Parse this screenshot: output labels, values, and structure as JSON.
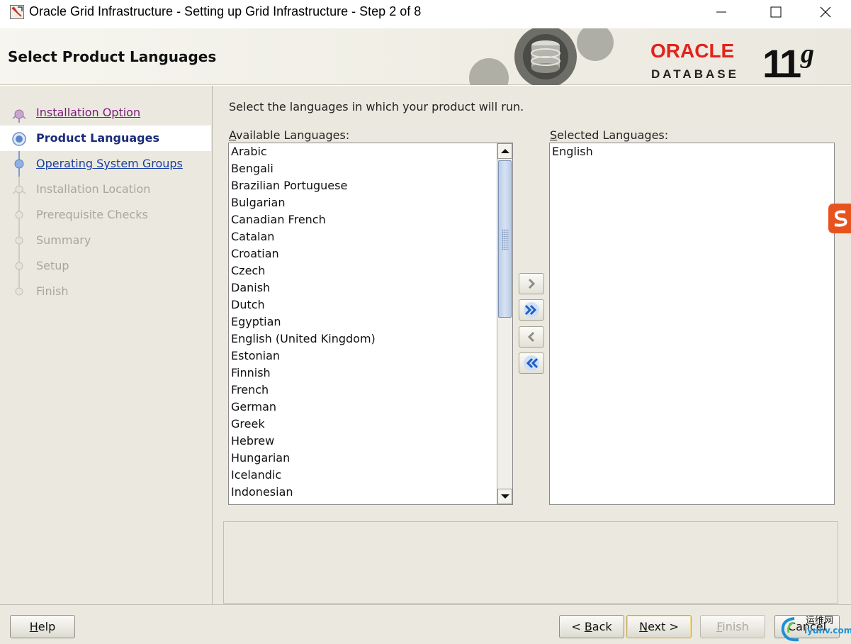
{
  "window": {
    "title": "Oracle Grid Infrastructure - Setting up Grid Infrastructure - Step 2 of 8"
  },
  "header": {
    "page_title": "Select Product Languages",
    "logo": {
      "brand": "ORACLE",
      "product": "DATABASE",
      "version_number": "11",
      "version_suffix": "g"
    }
  },
  "steps": [
    {
      "label": "Installation Option",
      "state": "done"
    },
    {
      "label": "Product Languages",
      "state": "active"
    },
    {
      "label": "Operating System Groups",
      "state": "next"
    },
    {
      "label": "Installation Location",
      "state": "disabled"
    },
    {
      "label": "Prerequisite Checks",
      "state": "disabled"
    },
    {
      "label": "Summary",
      "state": "disabled"
    },
    {
      "label": "Setup",
      "state": "disabled"
    },
    {
      "label": "Finish",
      "state": "disabled"
    }
  ],
  "content": {
    "instruction": "Select the languages in which your product will run.",
    "available_label_mnemonic": "A",
    "available_label_rest": "vailable Languages:",
    "selected_label_mnemonic": "S",
    "selected_label_rest": "elected Languages:",
    "available_languages": [
      "Arabic",
      "Bengali",
      "Brazilian Portuguese",
      "Bulgarian",
      "Canadian French",
      "Catalan",
      "Croatian",
      "Czech",
      "Danish",
      "Dutch",
      "Egyptian",
      "English (United Kingdom)",
      "Estonian",
      "Finnish",
      "French",
      "German",
      "Greek",
      "Hebrew",
      "Hungarian",
      "Icelandic",
      "Indonesian"
    ],
    "selected_languages": [
      "English"
    ]
  },
  "footer": {
    "help_mnemonic": "H",
    "help_rest": "elp",
    "back_prefix": "< ",
    "back_mnemonic": "B",
    "back_rest": "ack",
    "next_mnemonic": "N",
    "next_rest": "ext >",
    "finish_mnemonic": "F",
    "finish_rest": "inish",
    "cancel_label": "Cancel"
  },
  "watermark": {
    "line1": "运维网",
    "line2": "iyunv.com"
  },
  "colors": {
    "oracle_red": "#e2231a",
    "panel_bg": "#ebe9df",
    "active_step": "#1a2d7a",
    "visited_link": "#7a1a7a",
    "link": "#1a3fa0"
  }
}
